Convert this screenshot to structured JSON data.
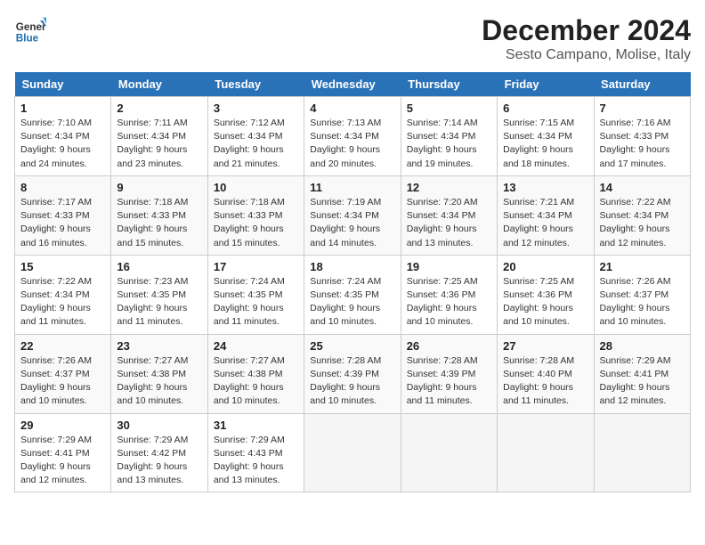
{
  "header": {
    "logo_line1": "General",
    "logo_line2": "Blue",
    "month_year": "December 2024",
    "location": "Sesto Campano, Molise, Italy"
  },
  "days_of_week": [
    "Sunday",
    "Monday",
    "Tuesday",
    "Wednesday",
    "Thursday",
    "Friday",
    "Saturday"
  ],
  "weeks": [
    [
      {
        "day": 1,
        "rise": "7:10 AM",
        "set": "4:34 PM",
        "daylight": "9 hours and 24 minutes."
      },
      {
        "day": 2,
        "rise": "7:11 AM",
        "set": "4:34 PM",
        "daylight": "9 hours and 23 minutes."
      },
      {
        "day": 3,
        "rise": "7:12 AM",
        "set": "4:34 PM",
        "daylight": "9 hours and 21 minutes."
      },
      {
        "day": 4,
        "rise": "7:13 AM",
        "set": "4:34 PM",
        "daylight": "9 hours and 20 minutes."
      },
      {
        "day": 5,
        "rise": "7:14 AM",
        "set": "4:34 PM",
        "daylight": "9 hours and 19 minutes."
      },
      {
        "day": 6,
        "rise": "7:15 AM",
        "set": "4:34 PM",
        "daylight": "9 hours and 18 minutes."
      },
      {
        "day": 7,
        "rise": "7:16 AM",
        "set": "4:33 PM",
        "daylight": "9 hours and 17 minutes."
      }
    ],
    [
      {
        "day": 8,
        "rise": "7:17 AM",
        "set": "4:33 PM",
        "daylight": "9 hours and 16 minutes."
      },
      {
        "day": 9,
        "rise": "7:18 AM",
        "set": "4:33 PM",
        "daylight": "9 hours and 15 minutes."
      },
      {
        "day": 10,
        "rise": "7:18 AM",
        "set": "4:33 PM",
        "daylight": "9 hours and 15 minutes."
      },
      {
        "day": 11,
        "rise": "7:19 AM",
        "set": "4:34 PM",
        "daylight": "9 hours and 14 minutes."
      },
      {
        "day": 12,
        "rise": "7:20 AM",
        "set": "4:34 PM",
        "daylight": "9 hours and 13 minutes."
      },
      {
        "day": 13,
        "rise": "7:21 AM",
        "set": "4:34 PM",
        "daylight": "9 hours and 12 minutes."
      },
      {
        "day": 14,
        "rise": "7:22 AM",
        "set": "4:34 PM",
        "daylight": "9 hours and 12 minutes."
      }
    ],
    [
      {
        "day": 15,
        "rise": "7:22 AM",
        "set": "4:34 PM",
        "daylight": "9 hours and 11 minutes."
      },
      {
        "day": 16,
        "rise": "7:23 AM",
        "set": "4:35 PM",
        "daylight": "9 hours and 11 minutes."
      },
      {
        "day": 17,
        "rise": "7:24 AM",
        "set": "4:35 PM",
        "daylight": "9 hours and 11 minutes."
      },
      {
        "day": 18,
        "rise": "7:24 AM",
        "set": "4:35 PM",
        "daylight": "9 hours and 10 minutes."
      },
      {
        "day": 19,
        "rise": "7:25 AM",
        "set": "4:36 PM",
        "daylight": "9 hours and 10 minutes."
      },
      {
        "day": 20,
        "rise": "7:25 AM",
        "set": "4:36 PM",
        "daylight": "9 hours and 10 minutes."
      },
      {
        "day": 21,
        "rise": "7:26 AM",
        "set": "4:37 PM",
        "daylight": "9 hours and 10 minutes."
      }
    ],
    [
      {
        "day": 22,
        "rise": "7:26 AM",
        "set": "4:37 PM",
        "daylight": "9 hours and 10 minutes."
      },
      {
        "day": 23,
        "rise": "7:27 AM",
        "set": "4:38 PM",
        "daylight": "9 hours and 10 minutes."
      },
      {
        "day": 24,
        "rise": "7:27 AM",
        "set": "4:38 PM",
        "daylight": "9 hours and 10 minutes."
      },
      {
        "day": 25,
        "rise": "7:28 AM",
        "set": "4:39 PM",
        "daylight": "9 hours and 10 minutes."
      },
      {
        "day": 26,
        "rise": "7:28 AM",
        "set": "4:39 PM",
        "daylight": "9 hours and 11 minutes."
      },
      {
        "day": 27,
        "rise": "7:28 AM",
        "set": "4:40 PM",
        "daylight": "9 hours and 11 minutes."
      },
      {
        "day": 28,
        "rise": "7:29 AM",
        "set": "4:41 PM",
        "daylight": "9 hours and 12 minutes."
      }
    ],
    [
      {
        "day": 29,
        "rise": "7:29 AM",
        "set": "4:41 PM",
        "daylight": "9 hours and 12 minutes."
      },
      {
        "day": 30,
        "rise": "7:29 AM",
        "set": "4:42 PM",
        "daylight": "9 hours and 13 minutes."
      },
      {
        "day": 31,
        "rise": "7:29 AM",
        "set": "4:43 PM",
        "daylight": "9 hours and 13 minutes."
      },
      null,
      null,
      null,
      null
    ]
  ]
}
